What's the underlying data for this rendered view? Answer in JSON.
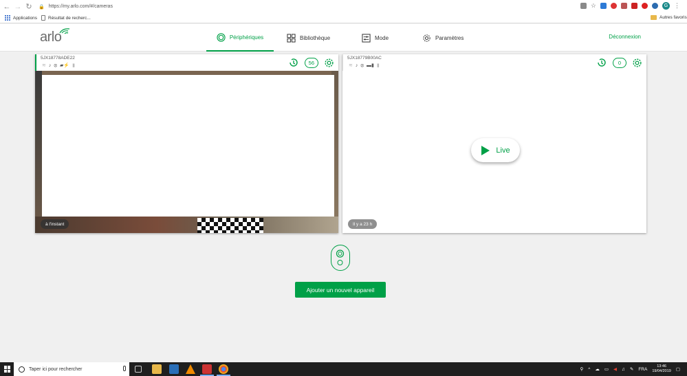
{
  "browser": {
    "url": "https://my.arlo.com/#/cameras",
    "bookmarks": {
      "apps": "Applications",
      "result": "Résultat de recherc...",
      "other": "Autres favoris"
    },
    "profile_initial": "G"
  },
  "app": {
    "logo": "arlo",
    "nav": {
      "devices": "Périphériques",
      "library": "Bibliothèque",
      "mode": "Mode",
      "settings": "Paramètres"
    },
    "logout": "Déconnexion"
  },
  "cameras": [
    {
      "name": "5JX18778ADE22",
      "clip_count": "56",
      "last_seen": "à l'instant"
    },
    {
      "name": "5JX18779B00AC",
      "clip_count": "0",
      "last_seen": "Il y a 23 h",
      "live_label": "Live"
    }
  ],
  "add_device_label": "Ajouter un nouvel appareil",
  "taskbar": {
    "search_placeholder": "Taper ici pour rechercher",
    "lang": "FRA",
    "time": "13:46",
    "date": "19/04/2019"
  },
  "colors": {
    "accent": "#00a047"
  }
}
